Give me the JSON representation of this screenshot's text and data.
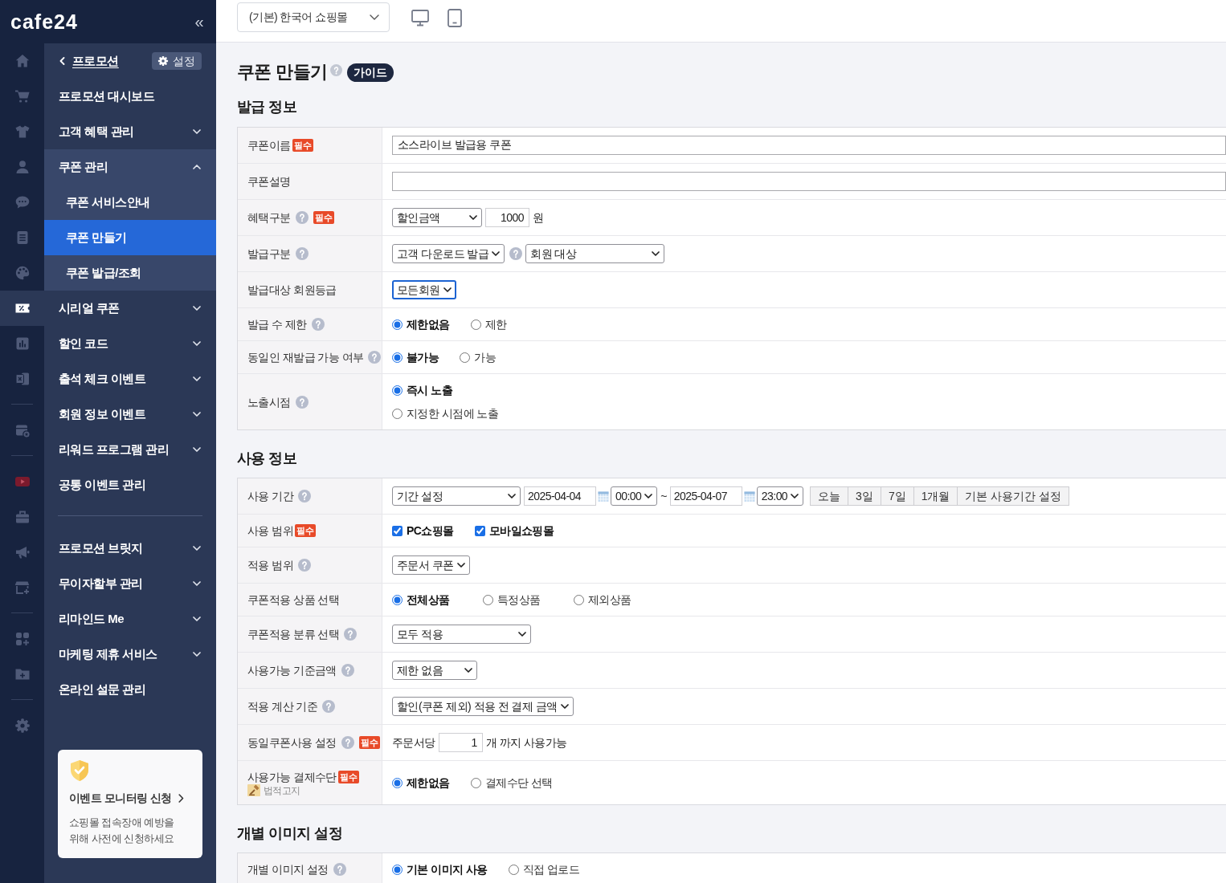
{
  "sidebar": {
    "logo": "cafe24",
    "collapse": "«",
    "rail": [
      [
        {
          "kind": "home",
          "selected": false
        },
        {
          "kind": "cart",
          "selected": false
        },
        {
          "kind": "shirt",
          "selected": false
        },
        {
          "kind": "person",
          "selected": false
        },
        {
          "kind": "chat",
          "selected": false
        },
        {
          "kind": "document",
          "selected": false
        },
        {
          "kind": "palette",
          "selected": false
        },
        {
          "kind": "coupon",
          "selected": true
        },
        {
          "kind": "chart",
          "selected": false
        },
        {
          "kind": "sheet",
          "selected": false
        }
      ],
      [
        {
          "kind": "calendar",
          "selected": false
        }
      ],
      [
        {
          "kind": "video",
          "selected": false
        },
        {
          "kind": "toolbox",
          "selected": false
        },
        {
          "kind": "megaphone",
          "selected": false
        },
        {
          "kind": "store",
          "selected": false
        }
      ],
      [
        {
          "kind": "apps",
          "selected": false
        },
        {
          "kind": "folder",
          "selected": false
        }
      ],
      [
        {
          "kind": "settings",
          "selected": false
        }
      ]
    ],
    "back_label": "프로모션",
    "settings_button": "설정",
    "menu": [
      [
        {
          "label": "프로모션 대시보드",
          "kind": "link",
          "selected": false
        },
        {
          "label": "고객 혜택 관리",
          "kind": "folder",
          "expanded": false,
          "selected": false
        },
        {
          "label": "쿠폰 관리",
          "kind": "folder",
          "expanded": true,
          "selected": false,
          "children": [
            {
              "label": "쿠폰 서비스안내",
              "selected": false
            },
            {
              "label": "쿠폰 만들기",
              "selected": true
            },
            {
              "label": "쿠폰 발급/조회",
              "selected": false
            }
          ]
        },
        {
          "label": "시리얼 쿠폰",
          "kind": "folder",
          "expanded": false,
          "selected": false
        },
        {
          "label": "할인 코드",
          "kind": "folder",
          "expanded": false,
          "selected": false
        },
        {
          "label": "출석 체크 이벤트",
          "kind": "folder",
          "expanded": false,
          "selected": false
        },
        {
          "label": "회원 정보 이벤트",
          "kind": "folder",
          "expanded": false,
          "selected": false
        },
        {
          "label": "리워드 프로그램 관리",
          "kind": "folder",
          "expanded": false,
          "selected": false
        },
        {
          "label": "공통 이벤트 관리",
          "kind": "link",
          "selected": false
        }
      ],
      [
        {
          "label": "프로모션 브릿지",
          "kind": "folder",
          "expanded": false,
          "selected": false
        },
        {
          "label": "무이자할부 관리",
          "kind": "folder",
          "expanded": false,
          "selected": false
        },
        {
          "label": "리마인드 Me",
          "kind": "folder",
          "expanded": false,
          "selected": false
        },
        {
          "label": "마케팅 제휴 서비스",
          "kind": "folder",
          "expanded": false,
          "selected": false
        },
        {
          "label": "온라인 설문 관리",
          "kind": "link",
          "selected": false
        }
      ]
    ],
    "promo_card": {
      "title": "이벤트 모니터링 신청",
      "text": "쇼핑몰 접속장애 예방을 위해 사전에 신청하세요"
    }
  },
  "topbar": {
    "store_select": "(기본) 한국어 쇼핑몰"
  },
  "page": {
    "title": "쿠폰 만들기",
    "guide": "가이드"
  },
  "sections": [
    {
      "title": "발급 정보",
      "rows": [
        {
          "label": "쿠폰이름",
          "help": false,
          "badge": "필수",
          "lines": [
            [
              {
                "kind": "input",
                "value": "소스라이브 발급용 쿠폰"
              }
            ]
          ]
        },
        {
          "label": "쿠폰설명",
          "help": false,
          "lines": [
            [
              {
                "kind": "input"
              }
            ]
          ]
        },
        {
          "label": "혜택구분",
          "help": true,
          "badge": "필수",
          "lines": [
            [
              {
                "kind": "select",
                "value": "할인금액",
                "focused": false
              },
              {
                "kind": "number",
                "value": "1000"
              },
              {
                "kind": "text",
                "text": "원"
              }
            ]
          ]
        },
        {
          "label": "발급구분",
          "help": true,
          "lines": [
            [
              {
                "kind": "select",
                "value": "고객 다운로드 발급",
                "focused": false
              },
              {
                "kind": "help"
              },
              {
                "kind": "select",
                "value": "회원 대상",
                "focused": false
              }
            ]
          ]
        },
        {
          "label": "발급대상 회원등급",
          "help": false,
          "lines": [
            [
              {
                "kind": "select",
                "value": "모든회원",
                "focused": true
              }
            ]
          ]
        },
        {
          "label": "발급 수 제한",
          "help": true,
          "lines": [
            [
              {
                "kind": "radio",
                "label": "제한없음",
                "selected": true
              },
              {
                "kind": "radio",
                "label": "제한",
                "selected": false
              }
            ]
          ]
        },
        {
          "label": "동일인 재발급 가능 여부",
          "help": true,
          "lines": [
            [
              {
                "kind": "radio",
                "label": "불가능",
                "selected": true
              },
              {
                "kind": "radio",
                "label": "가능",
                "selected": false
              }
            ]
          ]
        },
        {
          "label": "노출시점",
          "help": true,
          "lines": [
            [
              {
                "kind": "radio",
                "label": "즉시 노출",
                "selected": true
              }
            ],
            [
              {
                "kind": "radio",
                "label": "지정한 시점에 노출",
                "selected": false
              }
            ]
          ]
        }
      ]
    },
    {
      "title": "사용 정보",
      "rows": [
        {
          "label": "사용 기간",
          "help": true,
          "lines": [
            [
              {
                "kind": "select",
                "value": "기간 설정",
                "focused": false
              },
              {
                "kind": "date",
                "value": "2025-04-04"
              },
              {
                "kind": "select",
                "value": "00:00",
                "focused": false
              },
              {
                "kind": "text",
                "text": "~"
              },
              {
                "kind": "date",
                "value": "2025-04-07"
              },
              {
                "kind": "select",
                "value": "23:00",
                "focused": false
              },
              {
                "kind": "buttons",
                "items": [
                  "오늘",
                  "3일",
                  "7일",
                  "1개월",
                  "기본 사용기간 설정"
                ]
              }
            ]
          ]
        },
        {
          "label": "사용 범위",
          "help": false,
          "badge": "필수",
          "lines": [
            [
              {
                "kind": "checkbox",
                "label": "PC쇼핑몰",
                "checked": true
              },
              {
                "kind": "checkbox",
                "label": "모바일쇼핑몰",
                "checked": true
              }
            ]
          ]
        },
        {
          "label": "적용 범위",
          "help": true,
          "lines": [
            [
              {
                "kind": "select",
                "value": "주문서 쿠폰",
                "focused": false
              }
            ]
          ]
        },
        {
          "label": "쿠폰적용 상품 선택",
          "help": false,
          "lines": [
            [
              {
                "kind": "radio",
                "label": "전체상품",
                "selected": true
              },
              {
                "kind": "radio",
                "label": "특정상품",
                "selected": false
              },
              {
                "kind": "radio",
                "label": "제외상품",
                "selected": false
              }
            ]
          ]
        },
        {
          "label": "쿠폰적용 분류 선택",
          "help": true,
          "lines": [
            [
              {
                "kind": "select",
                "value": "모두 적용",
                "focused": false
              }
            ]
          ]
        },
        {
          "label": "사용가능 기준금액",
          "help": true,
          "lines": [
            [
              {
                "kind": "select",
                "value": "제한 없음",
                "focused": false
              }
            ]
          ]
        },
        {
          "label": "적용 계산 기준",
          "help": true,
          "lines": [
            [
              {
                "kind": "select",
                "value": "할인(쿠폰 제외) 적용 전 결제 금액",
                "focused": false
              }
            ]
          ]
        },
        {
          "label": "동일쿠폰사용 설정",
          "help": true,
          "badge": "필수",
          "lines": [
            [
              {
                "kind": "text",
                "text": "주문서당"
              },
              {
                "kind": "number",
                "value": "1"
              },
              {
                "kind": "text",
                "text": "개 까지 사용가능"
              }
            ]
          ]
        },
        {
          "label": "사용가능 결제수단",
          "help": false,
          "badge": "필수",
          "note": "법적고지",
          "lines": [
            [
              {
                "kind": "radio",
                "label": "제한없음",
                "selected": true
              },
              {
                "kind": "radio",
                "label": "결제수단 선택",
                "selected": false
              }
            ]
          ]
        }
      ]
    },
    {
      "title": "개별 이미지 설정",
      "rows": [
        {
          "label": "개별 이미지 설정",
          "help": true,
          "lines": [
            [
              {
                "kind": "radio",
                "label": "기본 이미지 사용",
                "selected": true
              },
              {
                "kind": "radio",
                "label": "직접 업로드",
                "selected": false
              }
            ]
          ]
        }
      ]
    }
  ]
}
